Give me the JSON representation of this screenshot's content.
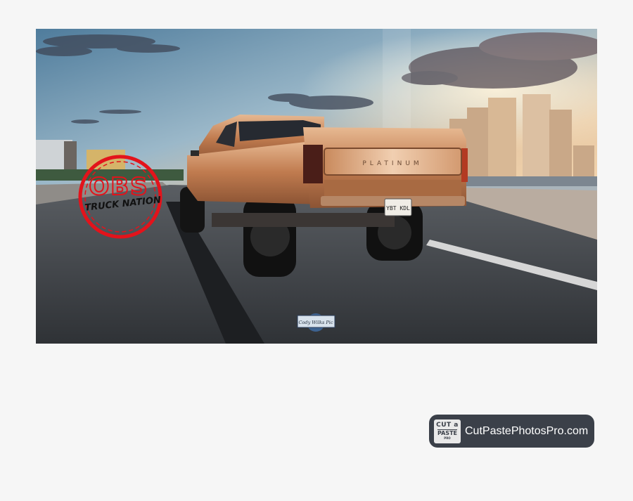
{
  "photo": {
    "watermark": {
      "line1": "OBS",
      "line2": "TRUCK NATION"
    },
    "license_plate": "YBT KDL",
    "tailgate_text": "PLATINUM",
    "signature_badge": "Cody Wilks Pic"
  },
  "brand": {
    "logo_line1": "CUT a",
    "logo_line2": "PASTE",
    "logo_line3": "PRO",
    "label": "CutPastePhotosPro.com"
  },
  "colors": {
    "background": "#f6f6f6",
    "brand_pill": "#3b4049",
    "watermark_red": "#e3131b"
  }
}
